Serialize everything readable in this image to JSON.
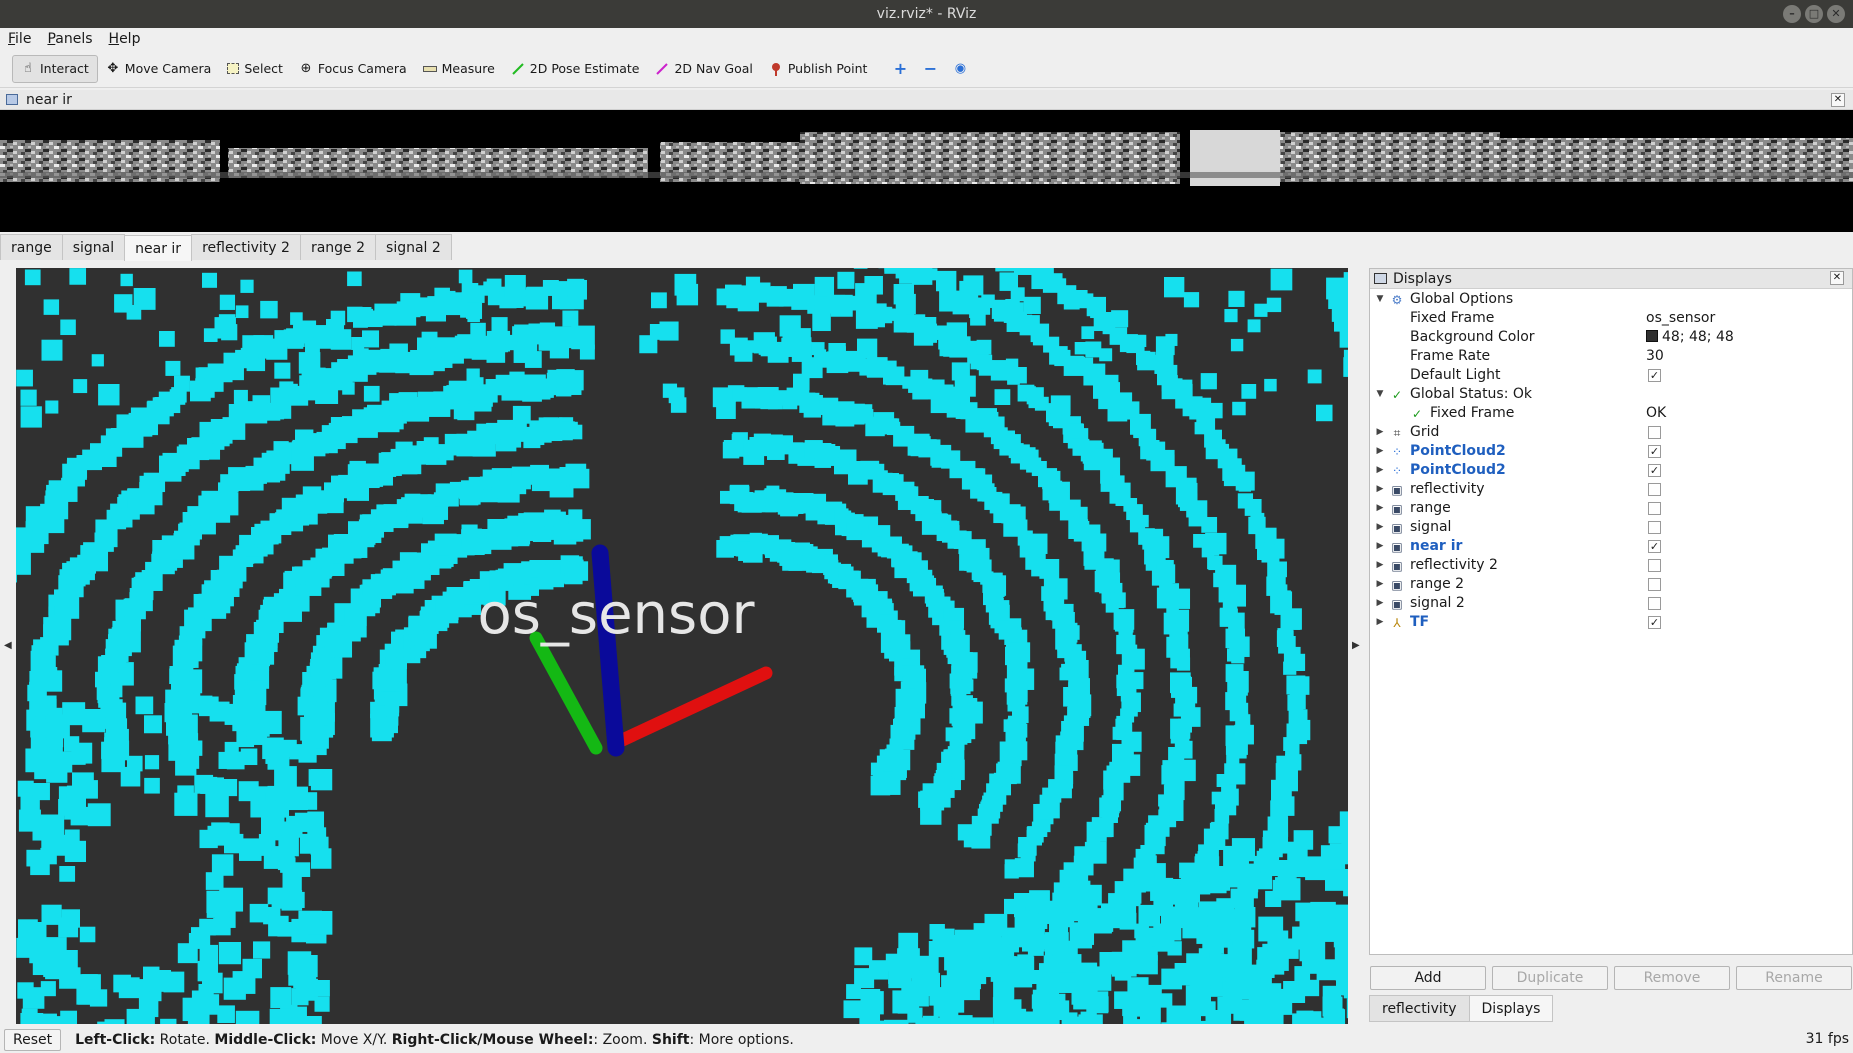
{
  "window": {
    "title": "viz.rviz* - RViz",
    "buttons": [
      "–",
      "□",
      "✕"
    ]
  },
  "menu": [
    "File",
    "Panels",
    "Help"
  ],
  "toolbar": {
    "tools": [
      {
        "label": "Interact",
        "icon": "hand-icon",
        "active": true
      },
      {
        "label": "Move Camera",
        "icon": "move-icon"
      },
      {
        "label": "Select",
        "icon": "select-icon"
      },
      {
        "label": "Focus Camera",
        "icon": "focus-icon"
      },
      {
        "label": "Measure",
        "icon": "ruler-icon"
      },
      {
        "label": "2D Pose Estimate",
        "icon": "pose-arrow-icon"
      },
      {
        "label": "2D Nav Goal",
        "icon": "goal-arrow-icon"
      },
      {
        "label": "Publish Point",
        "icon": "pin-icon"
      }
    ]
  },
  "image_panel": {
    "title": "near ir"
  },
  "image_tabs": [
    {
      "label": "range"
    },
    {
      "label": "signal"
    },
    {
      "label": "near ir",
      "selected": true
    },
    {
      "label": "reflectivity 2"
    },
    {
      "label": "range 2"
    },
    {
      "label": "signal 2"
    }
  ],
  "view3d": {
    "background": "#303030",
    "point_color": "#16e0ee",
    "frame_label": "os_sensor",
    "axis_colors": {
      "x": "#e01010",
      "y": "#14b814",
      "z": "#0a0a9a"
    }
  },
  "displays": {
    "title": "Displays",
    "global_options": {
      "label": "Global Options",
      "fixed_frame_label": "Fixed Frame",
      "fixed_frame_value": "os_sensor",
      "background_color_label": "Background Color",
      "background_color_value": "48; 48; 48",
      "frame_rate_label": "Frame Rate",
      "frame_rate_value": "30",
      "default_light_label": "Default Light"
    },
    "global_status": {
      "label": "Global Status: Ok",
      "fixed_frame_label": "Fixed Frame",
      "fixed_frame_value": "OK"
    },
    "items": [
      {
        "label": "Grid",
        "checked": false,
        "bold": false
      },
      {
        "label": "PointCloud2",
        "checked": true,
        "bold": true
      },
      {
        "label": "PointCloud2",
        "checked": true,
        "bold": true
      },
      {
        "label": "reflectivity",
        "checked": false,
        "bold": false
      },
      {
        "label": "range",
        "checked": false,
        "bold": false
      },
      {
        "label": "signal",
        "checked": false,
        "bold": false
      },
      {
        "label": "near ir",
        "checked": true,
        "bold": true
      },
      {
        "label": "reflectivity 2",
        "checked": false,
        "bold": false
      },
      {
        "label": "range 2",
        "checked": false,
        "bold": false
      },
      {
        "label": "signal 2",
        "checked": false,
        "bold": false
      },
      {
        "label": "TF",
        "checked": true,
        "bold": true
      }
    ],
    "buttons": {
      "add": "Add",
      "duplicate": "Duplicate",
      "remove": "Remove",
      "rename": "Rename"
    },
    "bottom_tabs": [
      {
        "label": "reflectivity"
      },
      {
        "label": "Displays",
        "selected": true
      }
    ]
  },
  "status": {
    "reset": "Reset",
    "left_click": "Left-Click:",
    "left_click_action": " Rotate. ",
    "middle_click": "Middle-Click:",
    "middle_click_action": " Move X/Y. ",
    "right_click": "Right-Click/Mouse Wheel:",
    "right_click_action": ": Zoom. ",
    "shift": "Shift",
    "shift_action": ": More options.",
    "fps": "31 fps"
  }
}
